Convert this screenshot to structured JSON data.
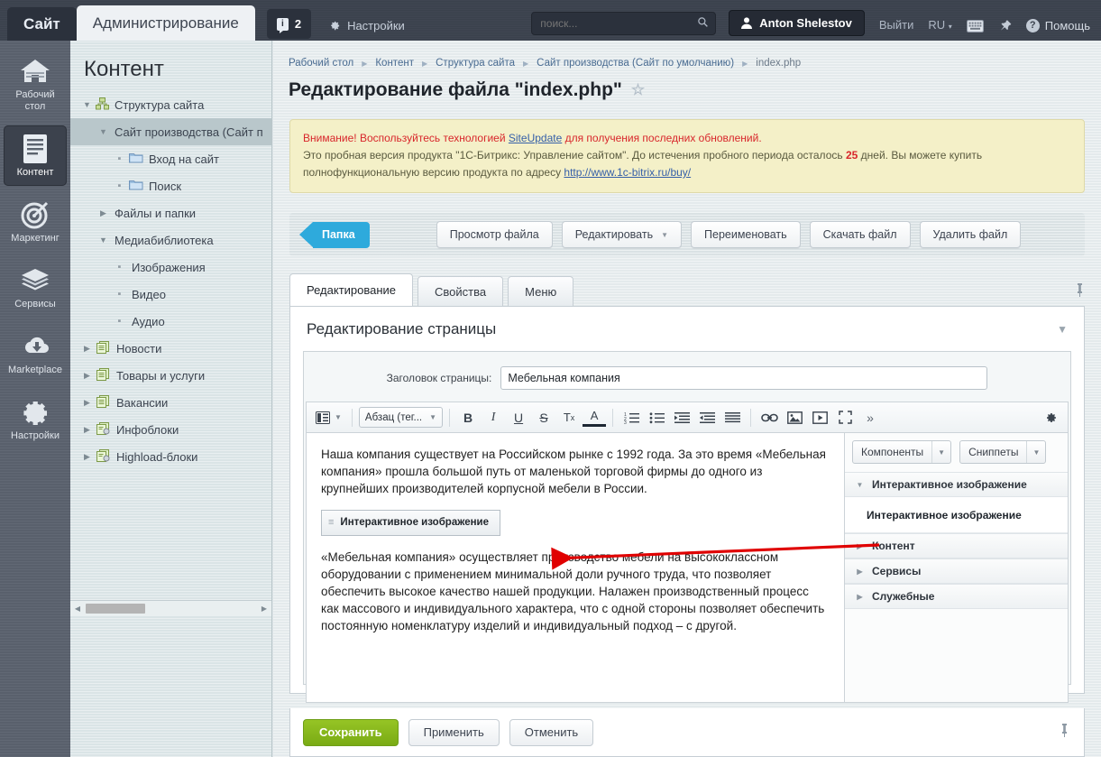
{
  "topbar": {
    "tab_site": "Сайт",
    "tab_admin": "Администрирование",
    "badge_icon": "info-icon",
    "badge_count": "2",
    "settings_label": "Настройки",
    "settings_icon": "gear-icon",
    "search_placeholder": "поиск...",
    "search_value": "",
    "search_icon": "search-icon",
    "user_name": "Anton Shelestov",
    "user_icon": "user-icon",
    "logout_label": "Выйти",
    "lang_label": "RU",
    "keyboard_icon": "keyboard-icon",
    "pin_icon": "pin-icon",
    "help_label": "Помощь",
    "help_icon": "question-icon"
  },
  "rail": {
    "items": [
      {
        "label": "Рабочий стол",
        "icon": "home-icon",
        "active": false
      },
      {
        "label": "Контент",
        "icon": "document-icon",
        "active": true
      },
      {
        "label": "Маркетинг",
        "icon": "target-icon",
        "active": false
      },
      {
        "label": "Сервисы",
        "icon": "layers-icon",
        "active": false
      },
      {
        "label": "Marketplace",
        "icon": "cloud-download-icon",
        "active": false
      },
      {
        "label": "Настройки",
        "icon": "gear-icon",
        "active": false
      }
    ]
  },
  "tree": {
    "title": "Контент",
    "nodes": [
      {
        "label": "Структура сайта",
        "indent": 0,
        "twisty": "down",
        "icon": "sitemap-icon",
        "selected": false
      },
      {
        "label": "Сайт производства (Сайт п",
        "indent": 1,
        "twisty": "down",
        "icon": "",
        "selected": true
      },
      {
        "label": "Вход на сайт",
        "indent": 2,
        "twisty": "dot",
        "icon": "folder-icon",
        "selected": false
      },
      {
        "label": "Поиск",
        "indent": 2,
        "twisty": "dot",
        "icon": "folder-icon",
        "selected": false
      },
      {
        "label": "Файлы и папки",
        "indent": 1,
        "twisty": "right",
        "icon": "",
        "selected": false
      },
      {
        "label": "Медиабиблиотека",
        "indent": 1,
        "twisty": "down",
        "icon": "",
        "selected": false
      },
      {
        "label": "Изображения",
        "indent": 2,
        "twisty": "dot",
        "icon": "",
        "selected": false
      },
      {
        "label": "Видео",
        "indent": 2,
        "twisty": "dot",
        "icon": "",
        "selected": false
      },
      {
        "label": "Аудио",
        "indent": 2,
        "twisty": "dot",
        "icon": "",
        "selected": false
      },
      {
        "label": "Новости",
        "indent": 0,
        "twisty": "right",
        "icon": "iblock-icon",
        "selected": false
      },
      {
        "label": "Товары и услуги",
        "indent": 0,
        "twisty": "right",
        "icon": "iblock-icon",
        "selected": false
      },
      {
        "label": "Вакансии",
        "indent": 0,
        "twisty": "right",
        "icon": "iblock-icon",
        "selected": false
      },
      {
        "label": "Инфоблоки",
        "indent": 0,
        "twisty": "right",
        "icon": "iblock-gear-icon",
        "selected": false
      },
      {
        "label": "Highload-блоки",
        "indent": 0,
        "twisty": "right",
        "icon": "iblock-gear-icon",
        "selected": false
      }
    ]
  },
  "breadcrumbs": [
    "Рабочий стол",
    "Контент",
    "Структура сайта",
    "Сайт производства (Сайт по умолчанию)",
    "index.php"
  ],
  "page": {
    "title": "Редактирование файла \"index.php\"",
    "star_icon": "star-icon"
  },
  "notice": {
    "warn_word": "Внимание!",
    "line1_before": " Воспользуйтесь технологией ",
    "line1_link": "SiteUpdate",
    "line1_after": " для получения последних обновлений.",
    "line2_before": "Это пробная версия продукта \"1С-Битрикс: Управление сайтом\". До истечения пробного периода осталось ",
    "line2_days": "25",
    "line2_after": " дней. Вы можете купить полнофункциональную версию продукта по адресу ",
    "line2_link": "http://www.1c-bitrix.ru/buy/"
  },
  "toolbar": {
    "folder_label": "Папка",
    "view_file": "Просмотр файла",
    "edit": "Редактировать",
    "rename": "Переименовать",
    "download": "Скачать файл",
    "delete": "Удалить файл"
  },
  "tabs": [
    {
      "label": "Редактирование",
      "active": true
    },
    {
      "label": "Свойства",
      "active": false
    },
    {
      "label": "Меню",
      "active": false
    }
  ],
  "pin_icon": "pin-icon",
  "panel": {
    "heading": "Редактирование страницы",
    "collapse_icon": "chevron-down-icon",
    "title_label": "Заголовок страницы:",
    "title_value": "Мебельная компания",
    "title_placeholder": ""
  },
  "editor_toolbar": {
    "view_icon": "view-mode-icon",
    "format_select": "Абзац (тег...",
    "buttons": [
      {
        "icon": "bold-icon",
        "glyph": "B"
      },
      {
        "icon": "italic-icon",
        "glyph": "I"
      },
      {
        "icon": "underline-icon",
        "glyph": "U"
      },
      {
        "icon": "strikethrough-icon",
        "glyph": "S"
      },
      {
        "icon": "remove-format-icon",
        "glyph": "Tx"
      },
      {
        "icon": "text-color-icon",
        "glyph": "A"
      },
      {
        "icon": "ordered-list-icon",
        "glyph": ""
      },
      {
        "icon": "unordered-list-icon",
        "glyph": ""
      },
      {
        "icon": "indent-icon",
        "glyph": ""
      },
      {
        "icon": "outdent-icon",
        "glyph": ""
      },
      {
        "icon": "align-justify-icon",
        "glyph": ""
      },
      {
        "icon": "link-icon",
        "glyph": ""
      },
      {
        "icon": "image-icon",
        "glyph": ""
      },
      {
        "icon": "video-icon",
        "glyph": ""
      },
      {
        "icon": "fullscreen-icon",
        "glyph": ""
      },
      {
        "icon": "more-icon",
        "glyph": "»"
      }
    ],
    "settings_icon": "gear-icon"
  },
  "editor_body": {
    "paragraph1": "Наша компания существует на Российском рынке с 1992 года. За это время «Мебельная компания» прошла большой путь от маленькой торговой фирмы до одного из крупнейших производителей корпусной мебели в России.",
    "component_chip": "Интерактивное изображение",
    "paragraph2": "«Мебельная компания» осуществляет производство мебели на высококлассном оборудовании с применением минимальной доли ручного труда, что позволяет обеспечить высокое качество нашей продукции. Налажен производственный процесс как массового и индивидуального характера, что с одной стороны позволяет обеспечить постоянную номенклатуру изделий и индивидуальный подход – с другой."
  },
  "editor_side": {
    "components_btn": "Компоненты",
    "snippets_btn": "Сниппеты",
    "groups": [
      {
        "label": "Интерактивное изображение",
        "expanded": true,
        "items": [
          "Интерактивное изображение"
        ]
      },
      {
        "label": "Контент",
        "expanded": false,
        "items": []
      },
      {
        "label": "Сервисы",
        "expanded": false,
        "items": []
      },
      {
        "label": "Служебные",
        "expanded": false,
        "items": []
      }
    ]
  },
  "footer": {
    "save": "Сохранить",
    "apply": "Применить",
    "cancel": "Отменить",
    "pin_icon": "pin-icon"
  },
  "colors": {
    "accent_blue": "#2eaadc",
    "save_green": "#8bbb1f",
    "arrow_red": "#e00000",
    "topbar_dark": "#3b424e",
    "notice_bg": "#f4f0c8"
  },
  "annotation": {
    "arrow_icon": "red-arrow-icon"
  }
}
